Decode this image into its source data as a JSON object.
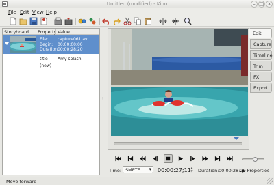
{
  "window": {
    "title": "Untitled (modified) - Kino"
  },
  "menu": [
    {
      "label": "File",
      "mnemonic": "F",
      "rest": "ile"
    },
    {
      "label": "Edit",
      "mnemonic": "E",
      "rest": "dit"
    },
    {
      "label": "View",
      "mnemonic": "V",
      "rest": "iew"
    },
    {
      "label": "Help",
      "mnemonic": "H",
      "rest": "elp"
    }
  ],
  "toolbar_icons": [
    "new-icon",
    "open-icon",
    "save-icon",
    "save-frame-icon",
    "publish-icon",
    "export-icon",
    "effects-icon",
    "undo-icon",
    "redo-icon",
    "cut-icon",
    "copy-icon",
    "paste-icon",
    "split-scene-icon",
    "join-scenes-icon",
    "zoom-icon"
  ],
  "storyboard": {
    "headers": {
      "storyboard": "Storyboard",
      "property": "Property",
      "value": "Value"
    },
    "clip": {
      "props": [
        {
          "key": "File:",
          "value": "capture061.avi"
        },
        {
          "key": "Begin:",
          "value": "00:00:00;00"
        },
        {
          "key": "Duration:",
          "value": "00:00:28;20"
        }
      ],
      "title_key": "title",
      "title_value": "Amy splash",
      "new_label": "(new)"
    }
  },
  "tabs": [
    "Edit",
    "Capture",
    "Timeline",
    "Trim",
    "FX",
    "Export"
  ],
  "active_tab": "Edit",
  "controls": {
    "time_label": "Time:",
    "time_format": "SMPTE",
    "timecode": "00:00:27;11",
    "duration_label": "Duration:",
    "duration": "00:00:28:20",
    "properties_label": "Properties",
    "playhead_fraction": 0.96
  },
  "status": {
    "text": "Move forward"
  },
  "colors": {
    "selection": "#5f8fcc",
    "accent": "#4b7bbf"
  }
}
